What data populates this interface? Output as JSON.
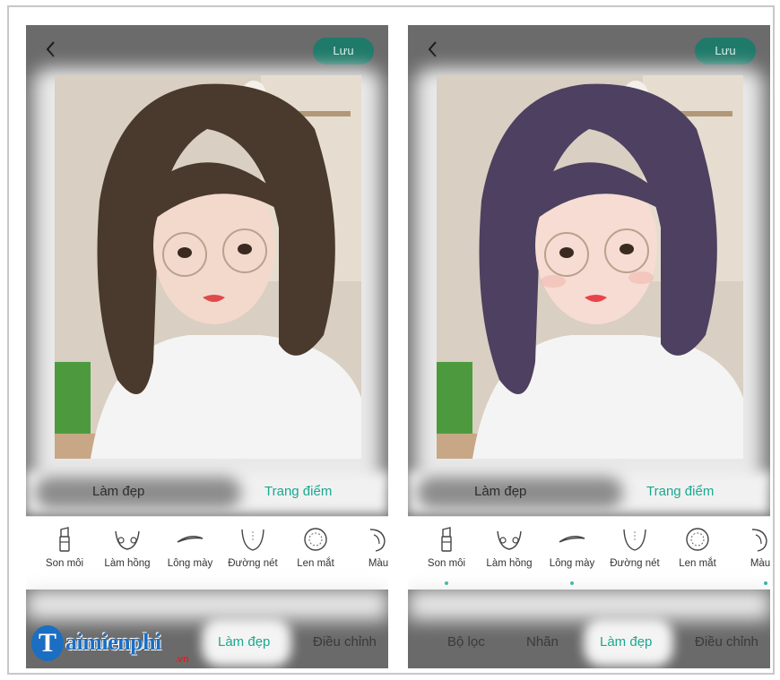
{
  "screens": [
    {
      "id": "before",
      "header": {
        "save_label": "Lưu"
      },
      "mode_tabs": [
        {
          "label": "Làm đẹp"
        },
        {
          "label": "Trang điểm"
        }
      ],
      "tools": [
        {
          "label": "Son môi",
          "icon": "lipstick-icon"
        },
        {
          "label": "Làm hồng",
          "icon": "blush-icon"
        },
        {
          "label": "Lông mày",
          "icon": "eyebrow-icon"
        },
        {
          "label": "Đường nét",
          "icon": "contour-icon"
        },
        {
          "label": "Len mắt",
          "icon": "eye-lens-icon"
        },
        {
          "label": "Màu",
          "icon": "hair-color-icon"
        }
      ],
      "bottom_tabs": [
        {
          "label": "Làm đẹp"
        },
        {
          "label": "Điều chỉnh"
        }
      ],
      "watermark": {
        "brand": "aimienphi",
        "letter": "T",
        "suffix": ".vn"
      }
    },
    {
      "id": "after",
      "header": {
        "save_label": "Lưu"
      },
      "mode_tabs": [
        {
          "label": "Làm đẹp"
        },
        {
          "label": "Trang điểm"
        }
      ],
      "tools": [
        {
          "label": "Son môi",
          "icon": "lipstick-icon"
        },
        {
          "label": "Làm hồng",
          "icon": "blush-icon"
        },
        {
          "label": "Lông mày",
          "icon": "eyebrow-icon"
        },
        {
          "label": "Đường nét",
          "icon": "contour-icon"
        },
        {
          "label": "Len mắt",
          "icon": "eye-lens-icon"
        },
        {
          "label": "Màu",
          "icon": "hair-color-icon"
        }
      ],
      "bottom_tabs": [
        {
          "label": "Bộ lọc"
        },
        {
          "label": "Nhãn"
        },
        {
          "label": "Làm đẹp"
        },
        {
          "label": "Điều chỉnh"
        }
      ]
    }
  ],
  "colors": {
    "accent": "#1ba891",
    "save_button": "#1f7a6a",
    "hair_before": "#4a3a2e",
    "hair_after": "#4d4060"
  }
}
